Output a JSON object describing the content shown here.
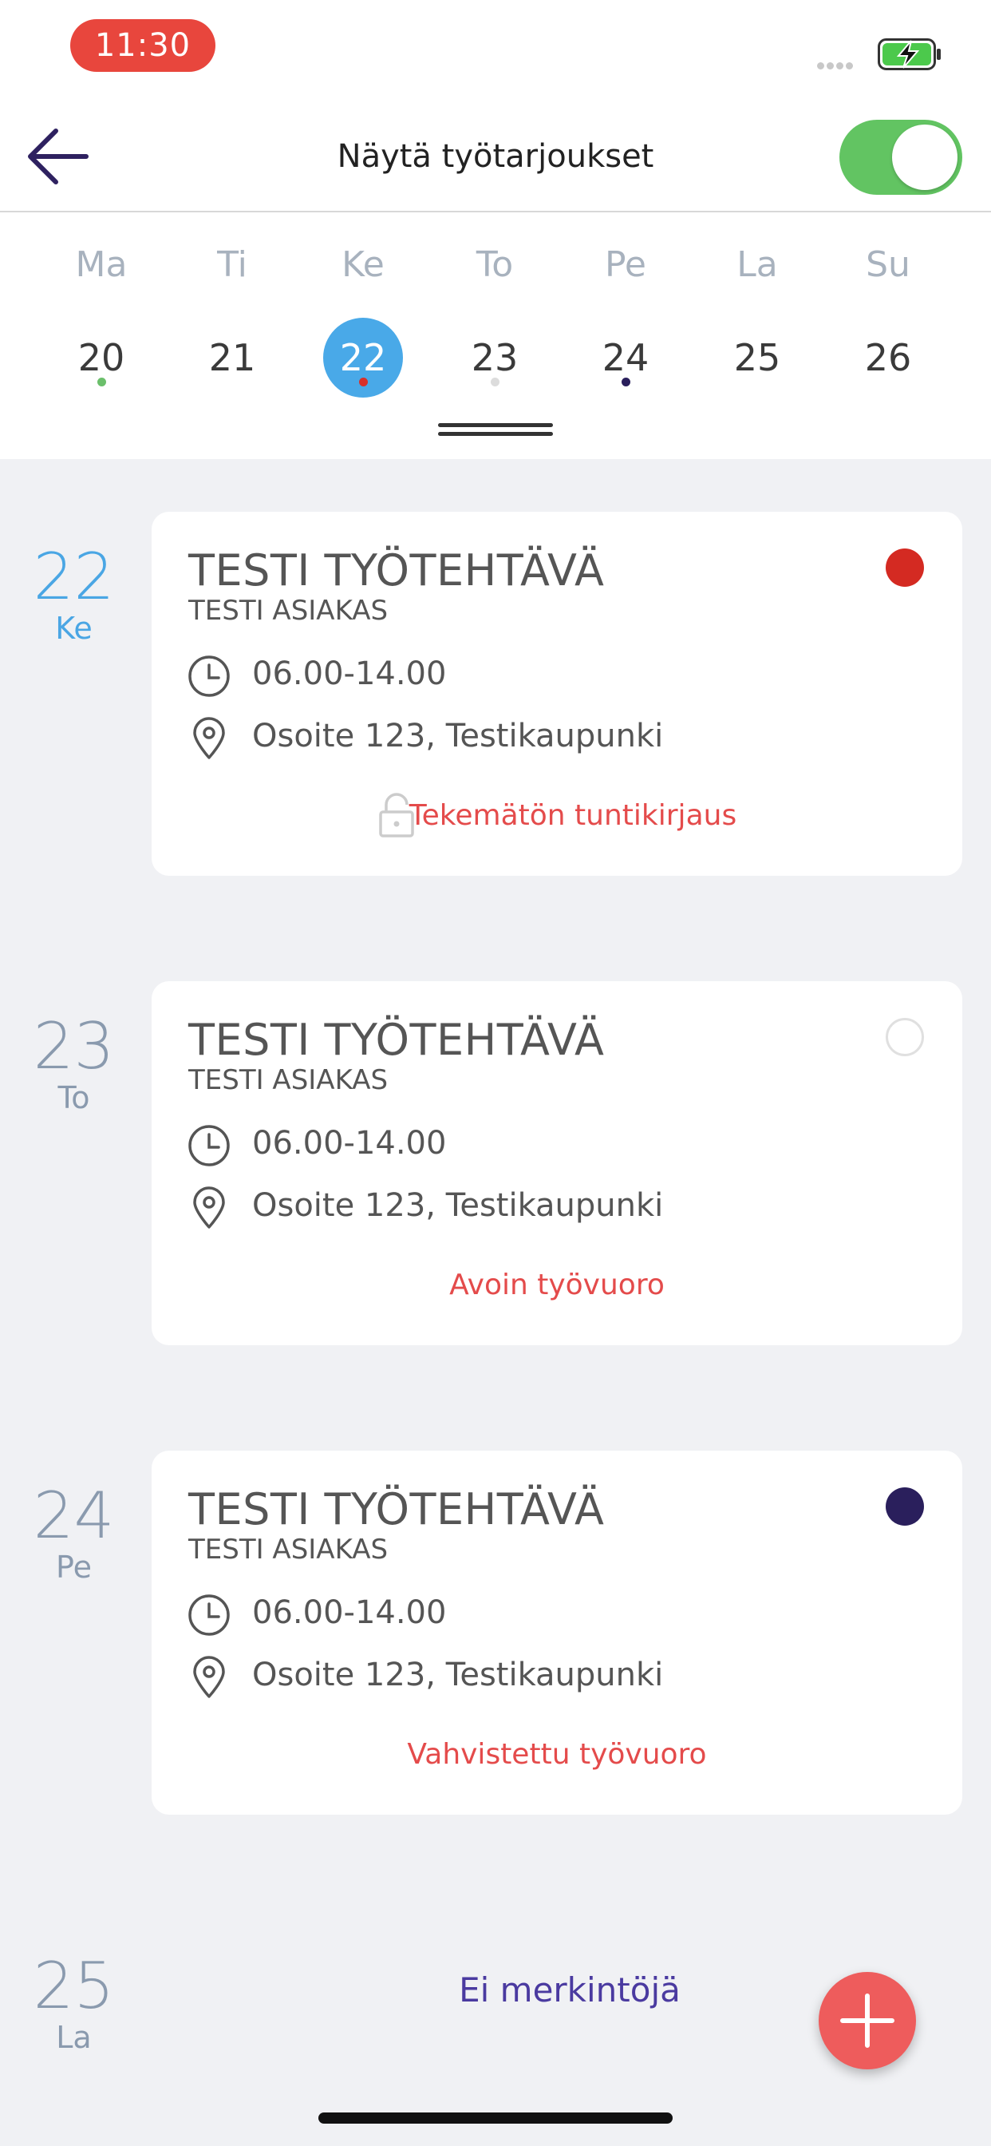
{
  "status_bar": {
    "time": "11:30"
  },
  "header": {
    "title": "Näytä työtarjoukset",
    "toggle_on": true
  },
  "week": {
    "labels": [
      "Ma",
      "Ti",
      "Ke",
      "To",
      "Pe",
      "La",
      "Su"
    ],
    "days": [
      "20",
      "21",
      "22",
      "23",
      "24",
      "25",
      "26"
    ],
    "selected_index": 2,
    "dots": [
      {
        "index": 0,
        "color": "#6bbf6b"
      },
      {
        "index": 2,
        "color": "#d8302a"
      },
      {
        "index": 3,
        "color": "#dcdcdc"
      },
      {
        "index": 4,
        "color": "#2a1f5c"
      }
    ]
  },
  "entries": [
    {
      "day": "22",
      "weekday": "Ke",
      "title": "TESTI TYÖTEHTÄVÄ",
      "customer": "TESTI ASIAKAS",
      "time": "06.00-14.00",
      "address": "Osoite 123, Testikaupunki",
      "status": "Tekemätön tuntikirjaus",
      "status_color": "#d42a22"
    },
    {
      "day": "23",
      "weekday": "To",
      "title": "TESTI TYÖTEHTÄVÄ",
      "customer": "TESTI ASIAKAS",
      "time": "06.00-14.00",
      "address": "Osoite 123, Testikaupunki",
      "status": "Avoin työvuoro",
      "status_color": "#ffffff"
    },
    {
      "day": "24",
      "weekday": "Pe",
      "title": "TESTI TYÖTEHTÄVÄ",
      "customer": "TESTI ASIAKAS",
      "time": "06.00-14.00",
      "address": "Osoite 123, Testikaupunki",
      "status": "Vahvistettu työvuoro",
      "status_color": "#2a1f5c"
    }
  ],
  "empty_day": {
    "day": "25",
    "weekday": "La",
    "text": "Ei merkintöjä"
  },
  "colors": {
    "accent_blue": "#49a9e8",
    "accent_red": "#ee5c5c",
    "toggle_green": "#62c462"
  }
}
